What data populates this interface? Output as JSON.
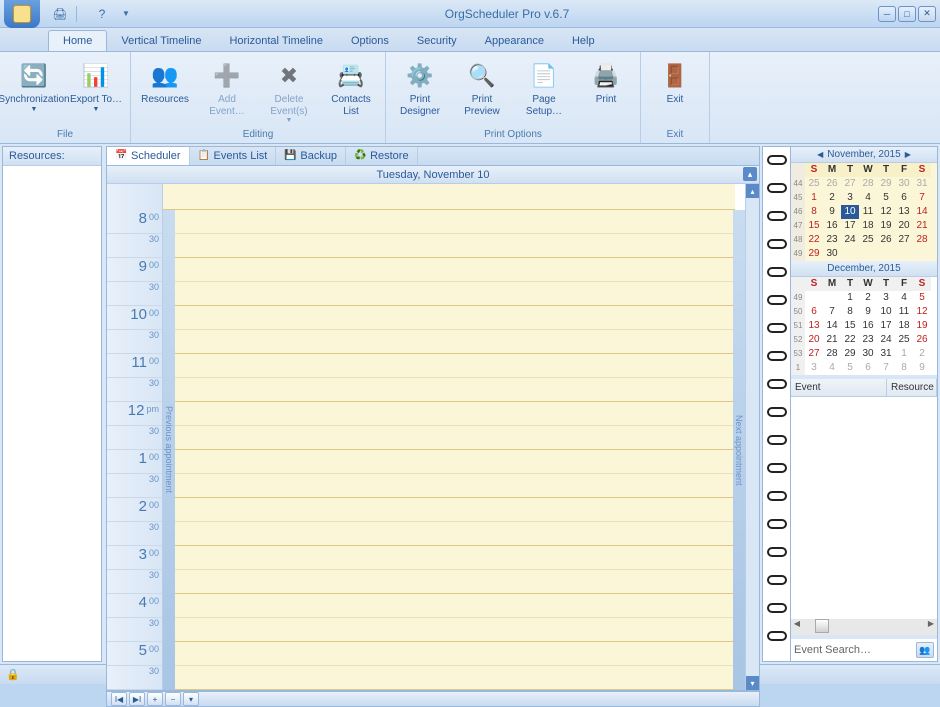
{
  "title": "OrgScheduler Pro v.6.7",
  "tabs": [
    "Home",
    "Vertical Timeline",
    "Horizontal Timeline",
    "Options",
    "Security",
    "Appearance",
    "Help"
  ],
  "active_tab": 0,
  "ribbon": {
    "groups": [
      {
        "label": "File",
        "buttons": [
          {
            "name": "synchronization",
            "label": "Synchronization",
            "dropdown": true,
            "icon": "🔄"
          },
          {
            "name": "export-to",
            "label": "Export To…",
            "dropdown": true,
            "icon": "📊"
          }
        ]
      },
      {
        "label": "Editing",
        "buttons": [
          {
            "name": "resources",
            "label": "Resources",
            "icon": "👥"
          },
          {
            "name": "add-event",
            "label": "Add Event…",
            "icon": "➕",
            "disabled": true
          },
          {
            "name": "delete-events",
            "label": "Delete Event(s)",
            "dropdown": true,
            "icon": "✖",
            "disabled": true
          },
          {
            "name": "contacts-list",
            "label": "Contacts List",
            "icon": "📇"
          }
        ]
      },
      {
        "label": "Print Options",
        "buttons": [
          {
            "name": "print-designer",
            "label": "Print Designer",
            "icon": "⚙️"
          },
          {
            "name": "print-preview",
            "label": "Print Preview",
            "icon": "🔍"
          },
          {
            "name": "page-setup",
            "label": "Page Setup…",
            "icon": "📄"
          },
          {
            "name": "print",
            "label": "Print",
            "icon": "🖨️"
          }
        ]
      },
      {
        "label": "Exit",
        "buttons": [
          {
            "name": "exit",
            "label": "Exit",
            "icon": "🚪"
          }
        ]
      }
    ]
  },
  "sidebar": {
    "header": "Resources:"
  },
  "doc_tabs": [
    {
      "name": "scheduler",
      "label": "Scheduler",
      "icon": "📅",
      "active": true
    },
    {
      "name": "events-list",
      "label": "Events List",
      "icon": "📋"
    },
    {
      "name": "backup",
      "label": "Backup",
      "icon": "💾"
    },
    {
      "name": "restore",
      "label": "Restore",
      "icon": "♻️"
    }
  ],
  "scheduler": {
    "date_label": "Tuesday, November 10",
    "prev_label": "Previous appointment",
    "next_label": "Next appointment",
    "hours": [
      {
        "h": "8",
        "m": "00",
        "ampm": ""
      },
      {
        "h": "9",
        "m": "00"
      },
      {
        "h": "10",
        "m": "00"
      },
      {
        "h": "11",
        "m": "00"
      },
      {
        "h": "12",
        "m": "pm"
      },
      {
        "h": "1",
        "m": "00"
      },
      {
        "h": "2",
        "m": "00"
      },
      {
        "h": "3",
        "m": "00"
      },
      {
        "h": "4",
        "m": "00"
      },
      {
        "h": "5",
        "m": "00"
      }
    ]
  },
  "calendars": [
    {
      "title": "November, 2015",
      "dow": [
        "S",
        "M",
        "T",
        "W",
        "T",
        "F",
        "S"
      ],
      "weeks": [
        {
          "wk": "44",
          "days": [
            {
              "d": "25",
              "o": 1
            },
            {
              "d": "26",
              "o": 1
            },
            {
              "d": "27",
              "o": 1
            },
            {
              "d": "28",
              "o": 1
            },
            {
              "d": "29",
              "o": 1
            },
            {
              "d": "30",
              "o": 1
            },
            {
              "d": "31",
              "o": 1
            }
          ]
        },
        {
          "wk": "45",
          "days": [
            {
              "d": "1"
            },
            {
              "d": "2"
            },
            {
              "d": "3"
            },
            {
              "d": "4"
            },
            {
              "d": "5"
            },
            {
              "d": "6"
            },
            {
              "d": "7"
            }
          ]
        },
        {
          "wk": "46",
          "days": [
            {
              "d": "8"
            },
            {
              "d": "9"
            },
            {
              "d": "10",
              "today": 1
            },
            {
              "d": "11"
            },
            {
              "d": "12"
            },
            {
              "d": "13"
            },
            {
              "d": "14"
            }
          ]
        },
        {
          "wk": "47",
          "days": [
            {
              "d": "15"
            },
            {
              "d": "16"
            },
            {
              "d": "17"
            },
            {
              "d": "18"
            },
            {
              "d": "19"
            },
            {
              "d": "20"
            },
            {
              "d": "21"
            }
          ]
        },
        {
          "wk": "48",
          "days": [
            {
              "d": "22"
            },
            {
              "d": "23"
            },
            {
              "d": "24"
            },
            {
              "d": "25"
            },
            {
              "d": "26"
            },
            {
              "d": "27"
            },
            {
              "d": "28"
            }
          ]
        },
        {
          "wk": "49",
          "days": [
            {
              "d": "29"
            },
            {
              "d": "30"
            },
            {
              "d": ""
            },
            {
              "d": ""
            },
            {
              "d": ""
            },
            {
              "d": ""
            },
            {
              "d": ""
            }
          ]
        }
      ]
    },
    {
      "title": "December, 2015",
      "dow": [
        "S",
        "M",
        "T",
        "W",
        "T",
        "F",
        "S"
      ],
      "weeks": [
        {
          "wk": "49",
          "days": [
            {
              "d": ""
            },
            {
              "d": ""
            },
            {
              "d": "1"
            },
            {
              "d": "2"
            },
            {
              "d": "3"
            },
            {
              "d": "4"
            },
            {
              "d": "5"
            }
          ]
        },
        {
          "wk": "50",
          "days": [
            {
              "d": "6"
            },
            {
              "d": "7"
            },
            {
              "d": "8"
            },
            {
              "d": "9"
            },
            {
              "d": "10"
            },
            {
              "d": "11"
            },
            {
              "d": "12"
            }
          ]
        },
        {
          "wk": "51",
          "days": [
            {
              "d": "13"
            },
            {
              "d": "14"
            },
            {
              "d": "15"
            },
            {
              "d": "16"
            },
            {
              "d": "17"
            },
            {
              "d": "18"
            },
            {
              "d": "19"
            }
          ]
        },
        {
          "wk": "52",
          "days": [
            {
              "d": "20"
            },
            {
              "d": "21"
            },
            {
              "d": "22"
            },
            {
              "d": "23"
            },
            {
              "d": "24"
            },
            {
              "d": "25"
            },
            {
              "d": "26"
            }
          ]
        },
        {
          "wk": "53",
          "days": [
            {
              "d": "27"
            },
            {
              "d": "28"
            },
            {
              "d": "29"
            },
            {
              "d": "30"
            },
            {
              "d": "31"
            },
            {
              "d": "1",
              "o": 1
            },
            {
              "d": "2",
              "o": 1
            }
          ]
        },
        {
          "wk": "1",
          "days": [
            {
              "d": "3",
              "o": 1
            },
            {
              "d": "4",
              "o": 1
            },
            {
              "d": "5",
              "o": 1
            },
            {
              "d": "6",
              "o": 1
            },
            {
              "d": "7",
              "o": 1
            },
            {
              "d": "8",
              "o": 1
            },
            {
              "d": "9",
              "o": 1
            }
          ]
        }
      ]
    }
  ],
  "event_list": {
    "cols": [
      "Event",
      "Resource"
    ]
  },
  "event_search": {
    "placeholder": "Event Search…"
  }
}
